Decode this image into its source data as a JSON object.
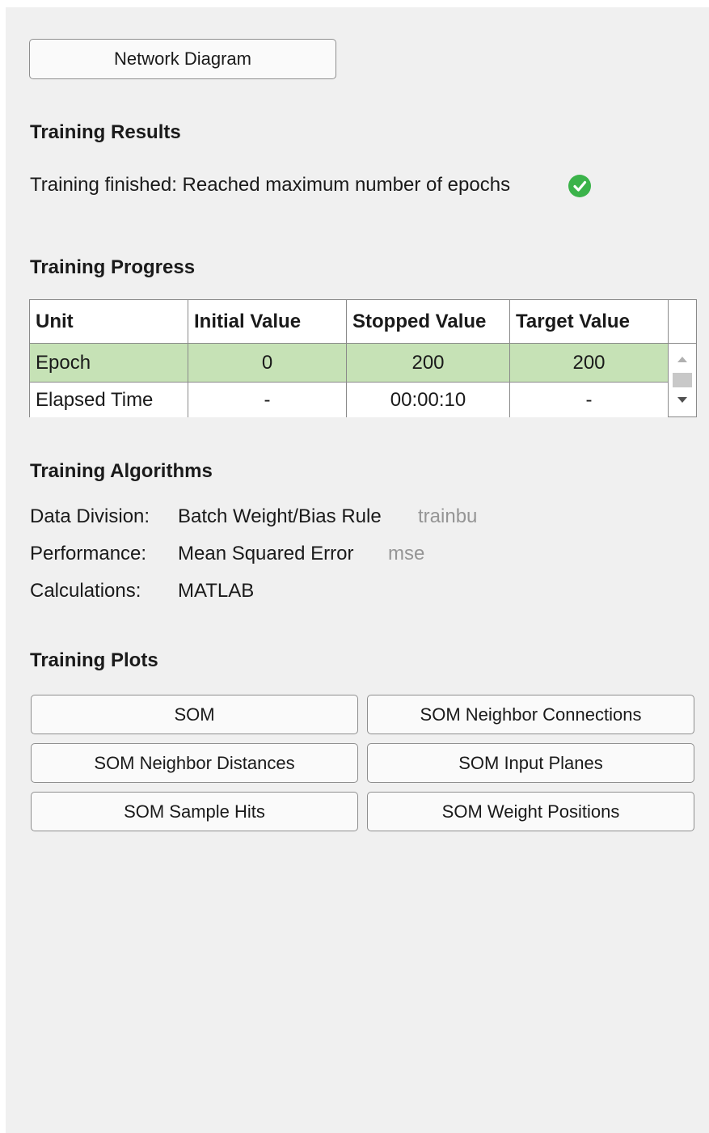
{
  "network_button": {
    "label": "Network Diagram"
  },
  "training_results": {
    "title": "Training Results",
    "status_text": "Training finished: Reached maximum number of epochs",
    "status_icon": "check-circle-icon",
    "status_color": "#3bb34a"
  },
  "training_progress": {
    "title": "Training Progress",
    "columns": [
      "Unit",
      "Initial Value",
      "Stopped Value",
      "Target Value"
    ],
    "rows": [
      {
        "unit": "Epoch",
        "initial": "0",
        "stopped": "200",
        "target": "200"
      },
      {
        "unit": "Elapsed Time",
        "initial": "-",
        "stopped": "00:00:10",
        "target": "-"
      }
    ],
    "highlight_color": "#c6e2b6"
  },
  "training_algorithms": {
    "title": "Training Algorithms",
    "items": [
      {
        "label": "Data Division:",
        "value": "Batch Weight/Bias Rule",
        "code": "trainbu"
      },
      {
        "label": "Performance:",
        "value": "Mean Squared Error",
        "code": "mse"
      },
      {
        "label": "Calculations:",
        "value": "MATLAB",
        "code": ""
      }
    ]
  },
  "training_plots": {
    "title": "Training Plots",
    "buttons": [
      "SOM",
      "SOM Neighbor Connections",
      "SOM Neighbor Distances",
      "SOM Input Planes",
      "SOM Sample Hits",
      "SOM Weight Positions"
    ]
  }
}
